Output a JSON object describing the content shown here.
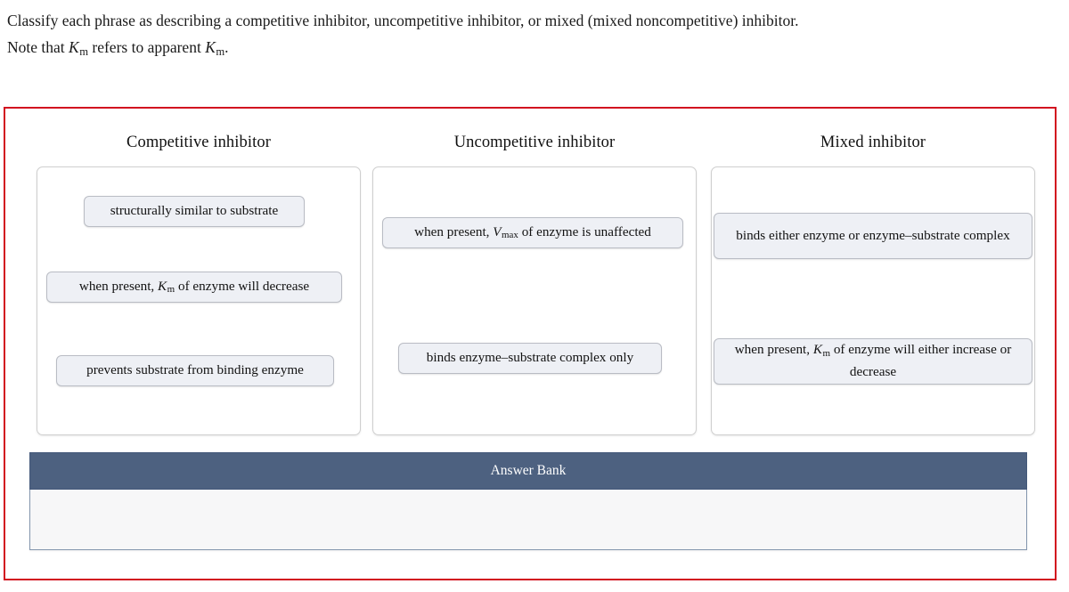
{
  "prompt": {
    "line1": "Classify each phrase as describing a competitive inhibitor, uncompetitive inhibitor, or mixed (mixed noncompetitive) inhibitor.",
    "line2_pre": "Note that ",
    "line2_k1": "K",
    "line2_k1_sub": "m",
    "line2_mid": " refers to apparent ",
    "line2_k2": "K",
    "line2_k2_sub": "m",
    "line2_end": "."
  },
  "columns": [
    {
      "title": "Competitive inhibitor",
      "tiles": [
        {
          "text": "structurally similar to substrate"
        },
        {
          "pre": "when present, ",
          "var": "K",
          "sub": "m",
          "post": " of enzyme will decrease"
        },
        {
          "text": "prevents substrate from binding enzyme"
        }
      ]
    },
    {
      "title": "Uncompetitive inhibitor",
      "tiles": [
        {
          "pre": "when present, ",
          "var": "V",
          "sub": "max",
          "post": " of enzyme is unaffected"
        },
        {
          "text": "binds enzyme–substrate complex only"
        }
      ]
    },
    {
      "title": "Mixed inhibitor",
      "tiles": [
        {
          "text": "binds either enzyme or enzyme–substrate complex"
        },
        {
          "pre": "when present, ",
          "var": "K",
          "sub": "m",
          "post": " of enzyme will either increase or decrease"
        }
      ]
    }
  ],
  "answer_bank": {
    "header_label": "Answer Bank",
    "items": []
  },
  "colors": {
    "frame_border": "#d2101f",
    "bank_header_bg": "#4d6180",
    "bank_body_bg": "#f7f7f8",
    "tile_bg": "#eef0f5",
    "dropzone_border": "#cfcfcf"
  }
}
